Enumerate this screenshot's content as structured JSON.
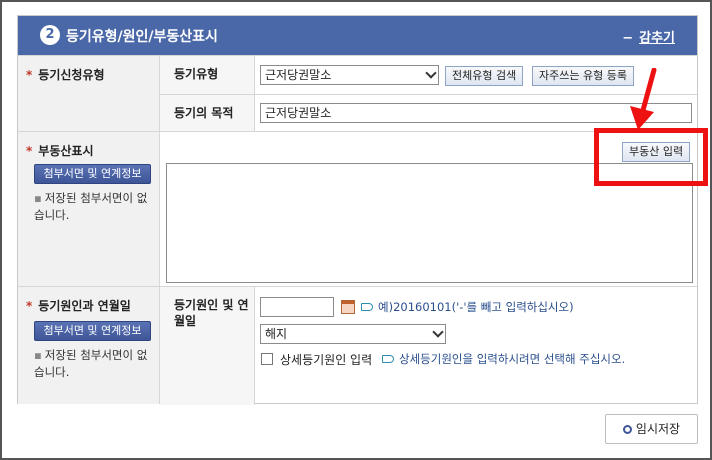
{
  "header": {
    "step": "2",
    "title": "등기유형/원인/부동산표시",
    "collapse_label": "감추기"
  },
  "row_type": {
    "label": "등기신청유형",
    "sub_type_label": "등기유형",
    "type_select": "근저당권말소",
    "btn_all_types": "전체유형 검색",
    "btn_register_freq": "자주쓰는 유형 등록",
    "sub_purpose_label": "등기의 목적",
    "purpose_value": "근저당권말소"
  },
  "row_property": {
    "label": "부동산표시",
    "attach_button": "첨부서면 및 연계정보",
    "note": "저장된 첨부서면이 없습니다.",
    "input_button": "부동산 입력"
  },
  "row_cause": {
    "label": "등기원인과 연월일",
    "attach_button": "첨부서면 및 연계정보",
    "note": "저장된 첨부서면이 없습니다.",
    "sub_label": "등기원인 및 연월일",
    "date_value": "",
    "date_hint": "예)20160101('-'를 빼고 입력하십시오)",
    "cause_select": "해지",
    "detail_checkbox_label": "상세등기원인 입력",
    "detail_hint": "상세등기원인을 입력하시려면 선택해 주십시오."
  },
  "footer": {
    "save_label": "임시저장"
  },
  "colors": {
    "header_bg": "#4a68a8",
    "highlight": "#ee1111",
    "required": "#c0392b"
  }
}
